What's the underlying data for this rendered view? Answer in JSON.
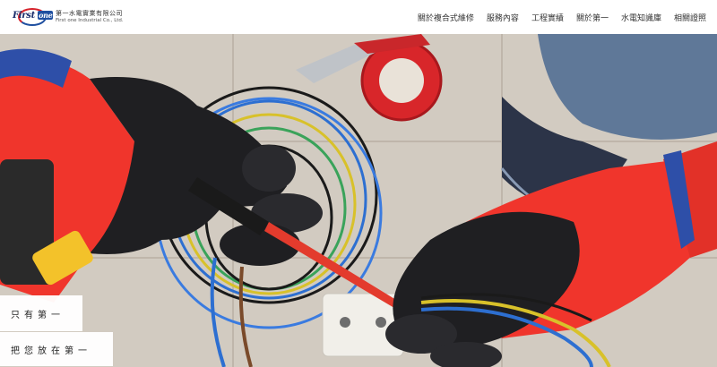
{
  "brand": {
    "logo_word": "First",
    "logo_badge": "one",
    "company_cn": "第一水電實業有限公司",
    "company_en": "First one Industrial Co., Ltd."
  },
  "nav": {
    "items": [
      {
        "label": "關於複合式維修"
      },
      {
        "label": "服務內容"
      },
      {
        "label": "工程實績"
      },
      {
        "label": "關於第一"
      },
      {
        "label": "水電知識庫"
      },
      {
        "label": "相關證照"
      }
    ]
  },
  "hero": {
    "slogan_line1": "只有第一",
    "slogan_line2": "把您放在第一"
  },
  "colors": {
    "brand_red": "#d6212a",
    "brand_blue": "#1f4fa0",
    "glove_red": "#f0352c",
    "glove_black": "#1f1f22"
  }
}
